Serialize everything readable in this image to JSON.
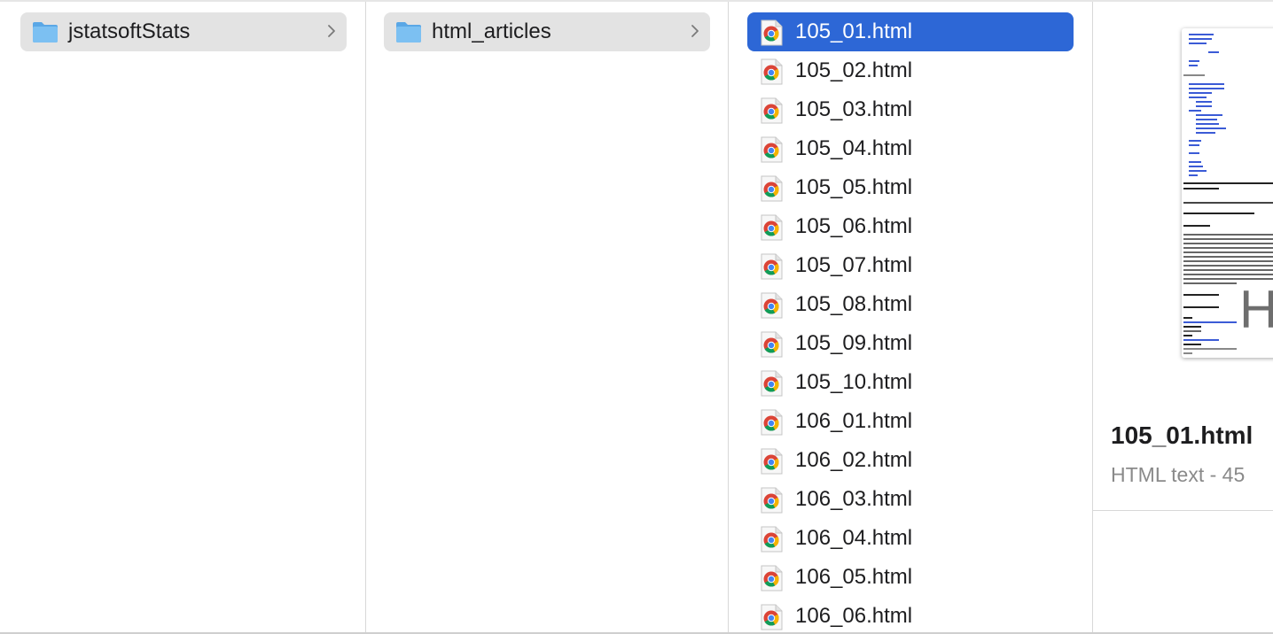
{
  "columns": {
    "col1": {
      "folder": "jstatsoftStats"
    },
    "col2": {
      "folder": "html_articles"
    },
    "col3": {
      "files": [
        "105_01.html",
        "105_02.html",
        "105_03.html",
        "105_04.html",
        "105_05.html",
        "105_06.html",
        "105_07.html",
        "105_08.html",
        "105_09.html",
        "105_10.html",
        "106_01.html",
        "106_02.html",
        "106_03.html",
        "106_04.html",
        "106_05.html",
        "106_06.html"
      ],
      "selected_index": 0
    }
  },
  "preview": {
    "file_name": "105_01.html",
    "kind_size": "HTML text - 45",
    "thumbnail_glyph": "H"
  },
  "colors": {
    "selection": "#2d67d6",
    "folder_row": "#e3e3e3",
    "folder_icon": "#6bb3ee"
  },
  "icons": {
    "folder": "folder-icon",
    "file": "chrome-html-file-icon",
    "disclosure": "chevron-right-icon"
  }
}
